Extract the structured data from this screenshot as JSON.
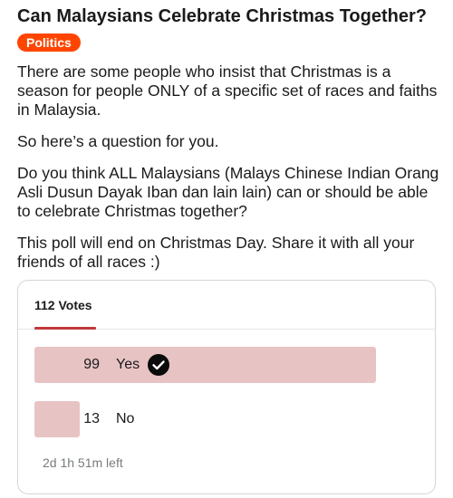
{
  "post": {
    "title": "Can Malaysians Celebrate Christmas Together?",
    "flair": "Politics",
    "flair_color": "#ff4500",
    "paragraphs": [
      "There are some people who insist that Christmas is a season for people ONLY of a specific set of races and faiths in Malaysia.",
      "So here’s a question for you.",
      "Do you think ALL Malaysians (Malays Chinese Indian Orang Asli Dusun Dayak Iban dan lain lain) can or should be able to celebrate Christmas together?",
      "This poll will end on Christmas Day. Share it with all your friends of all races :)"
    ]
  },
  "poll": {
    "total_votes": "112 Votes",
    "accent_color": "#c0393b",
    "bar_color": "#e8c3c4",
    "options": [
      {
        "count": "99",
        "label": "Yes",
        "fraction": 0.884,
        "selected": true,
        "icon": "checkmark-circle-icon"
      },
      {
        "count": "13",
        "label": "No",
        "fraction": 0.116,
        "selected": false
      }
    ],
    "time_left": "2d 1h 51m left"
  }
}
